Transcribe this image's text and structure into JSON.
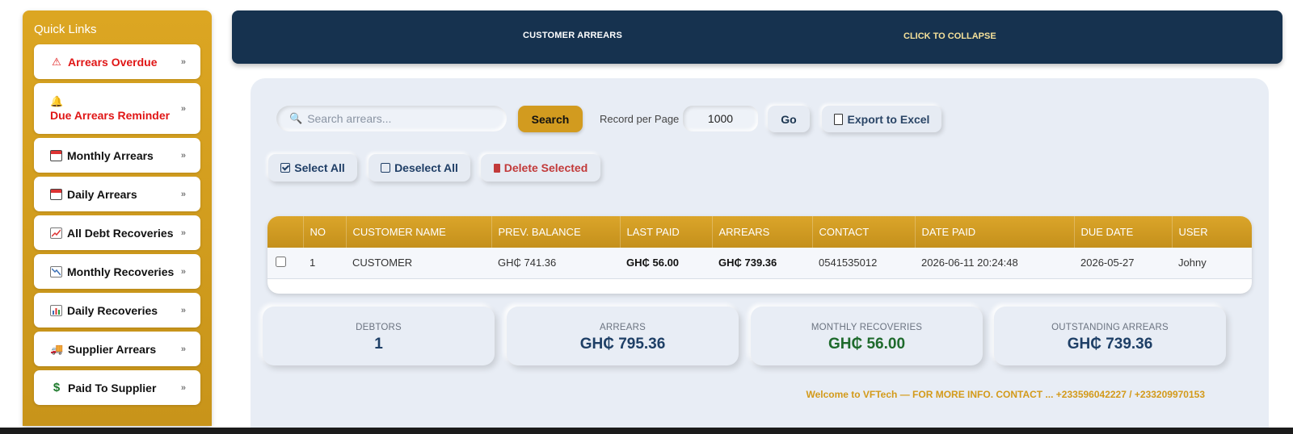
{
  "sidebar": {
    "title": "Quick Links",
    "items": [
      {
        "label": "Arrears Overdue",
        "icon": "warning-icon",
        "glyph": "⚠"
      },
      {
        "label": "Due Arrears Reminder",
        "icon": "bell-icon",
        "glyph": "🔔"
      },
      {
        "label": "Monthly Arrears",
        "icon": "calendar-icon"
      },
      {
        "label": "Daily Arrears",
        "icon": "calendar-day-icon"
      },
      {
        "label": "All Debt Recoveries",
        "icon": "chart-up-icon"
      },
      {
        "label": "Monthly Recoveries",
        "icon": "chart-down-icon"
      },
      {
        "label": "Daily Recoveries",
        "icon": "bar-chart-icon"
      },
      {
        "label": "Supplier Arrears",
        "icon": "truck-icon",
        "glyph": "🚚"
      },
      {
        "label": "Paid To Supplier",
        "icon": "dollar-icon",
        "glyph": "$"
      }
    ],
    "chevron": "»"
  },
  "header": {
    "title": "CUSTOMER ARREARS",
    "collapse": "CLICK TO COLLAPSE"
  },
  "toolbar": {
    "search_placeholder": "Search arrears...",
    "search_value": "",
    "search_button": "Search",
    "rpp_label": "Record per Page",
    "rpp_value": "1000",
    "go_button": "Go",
    "export_button": "Export to Excel",
    "select_all": "Select All",
    "deselect_all": "Deselect All",
    "delete_selected": "Delete Selected"
  },
  "table": {
    "columns": [
      "",
      "NO",
      "CUSTOMER NAME",
      "PREV. BALANCE",
      "LAST PAID",
      "ARREARS",
      "CONTACT",
      "DATE PAID",
      "DUE DATE",
      "USER"
    ],
    "rows": [
      {
        "no": "1",
        "customer": "CUSTOMER",
        "prev_balance": "GH₵ 741.36",
        "last_paid": "GH₵ 56.00",
        "arrears": "GH₵ 739.36",
        "contact": "0541535012",
        "date_paid": "2026-06-11 20:24:48",
        "due_date": "2026-05-27",
        "user": "Johny"
      }
    ]
  },
  "stats": [
    {
      "label": "DEBTORS",
      "value": "1"
    },
    {
      "label": "ARREARS",
      "value": "GH₵ 795.36"
    },
    {
      "label": "MONTHLY RECOVERIES",
      "value": "GH₵ 56.00"
    },
    {
      "label": "OUTSTANDING ARREARS",
      "value": "GH₵ 739.36"
    }
  ],
  "footer": "Welcome to VFTech — FOR MORE INFO. CONTACT ... +233596042227 / +233209970153",
  "colors": {
    "brand_gold": "#d29b1f",
    "header_navy": "#16324f",
    "alert_red": "#e01616",
    "green": "#1e6a2c"
  }
}
